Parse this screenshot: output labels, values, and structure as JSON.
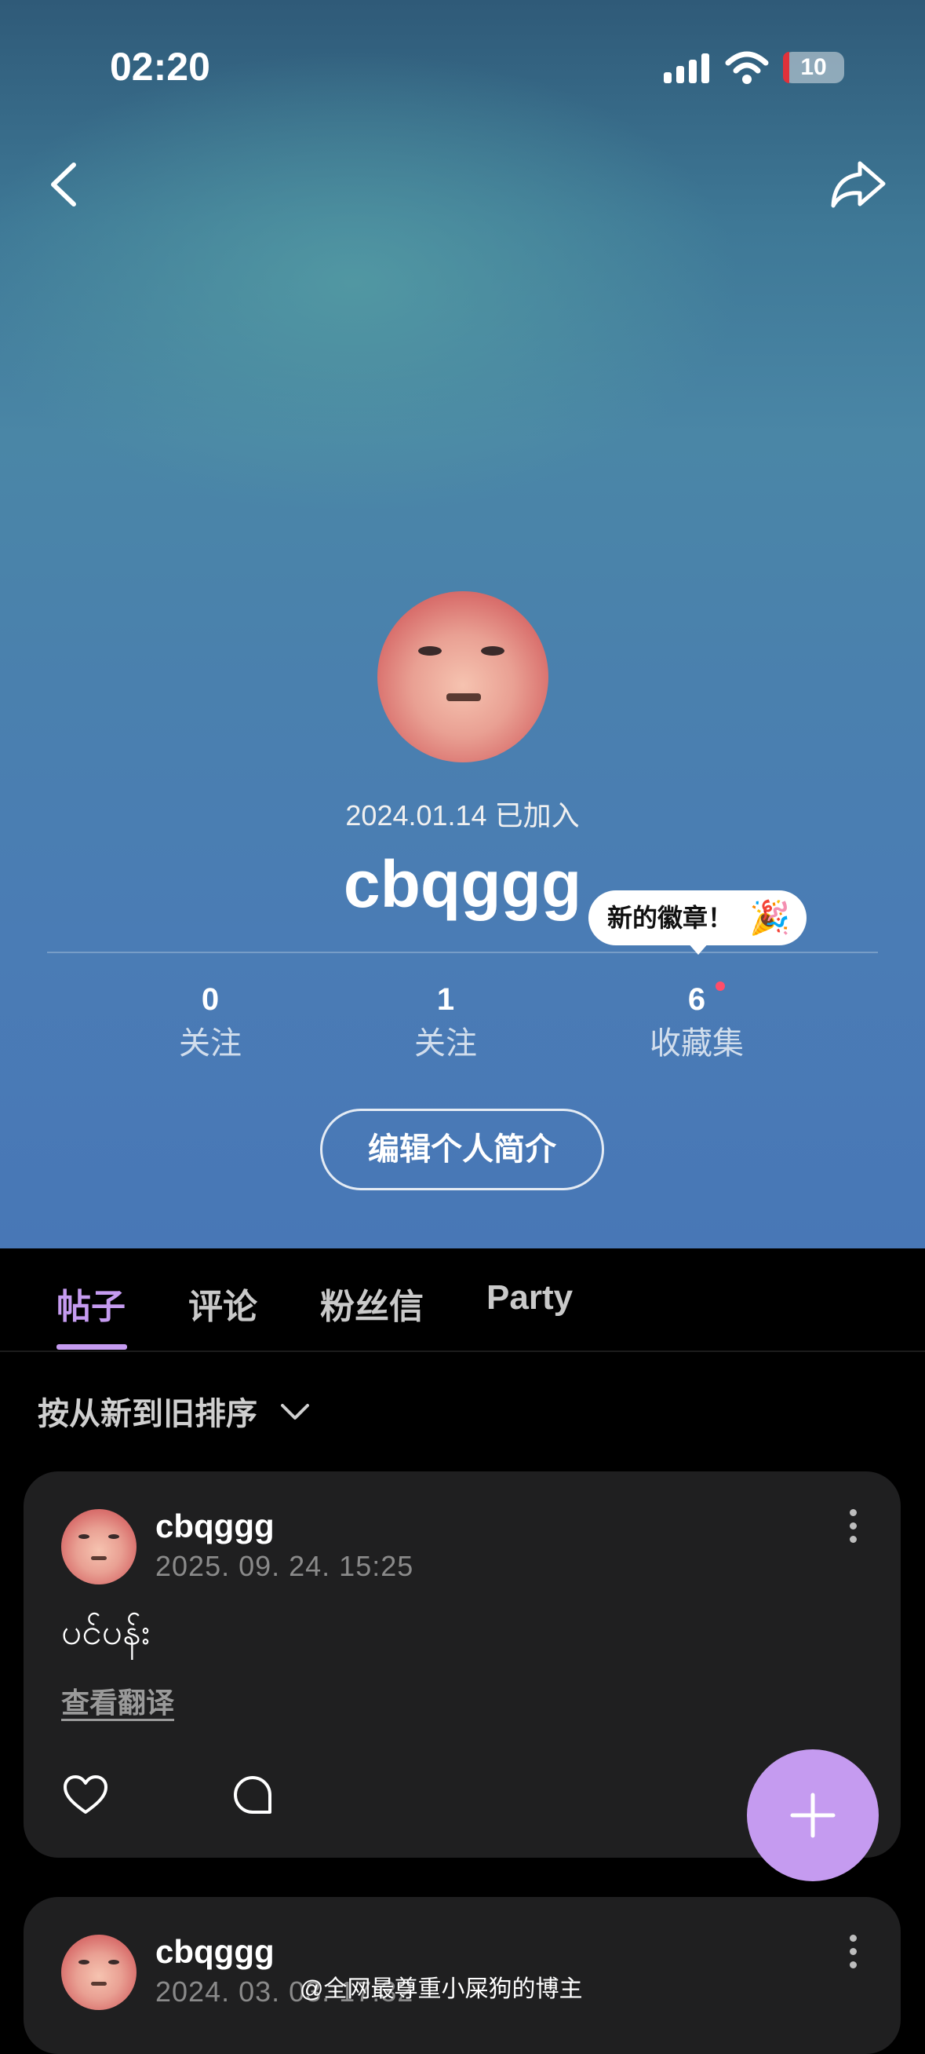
{
  "status_bar": {
    "time": "02:20",
    "battery_level": "10",
    "battery_fraction": 0.1,
    "battery_color": "#e0313a"
  },
  "nav": {
    "back_icon": "chevron-left-icon",
    "share_icon": "share-arrow-icon"
  },
  "profile": {
    "join_date": "2024.01.14 已加入",
    "username": "cbqggg",
    "badge_tooltip": "新的徽章！",
    "badge_emoji": "🎉",
    "stats": [
      {
        "value": "0",
        "label": "关注"
      },
      {
        "value": "1",
        "label": "关注"
      },
      {
        "value": "6",
        "label": "收藏集"
      }
    ],
    "edit_button": "编辑个人简介"
  },
  "tabs": [
    {
      "label": "帖子",
      "active": true
    },
    {
      "label": "评论",
      "active": false
    },
    {
      "label": "粉丝信",
      "active": false
    },
    {
      "label": "Party",
      "active": false
    }
  ],
  "sort_label": "按从新到旧排序",
  "posts": [
    {
      "author": "cbqggg",
      "date": "2025. 09. 24. 15:25",
      "text": "ပင်ပန်း",
      "translate_label": "查看翻译"
    },
    {
      "author": "cbqggg",
      "date": "2024. 03. 03. 17:32"
    }
  ],
  "fab_icon": "plus-icon",
  "watermark": "@全网最尊重小屎狗的博主",
  "colors": {
    "accent": "#c59bf0",
    "card_bg": "#1f1f20",
    "notification_dot": "#ff4d6a"
  }
}
